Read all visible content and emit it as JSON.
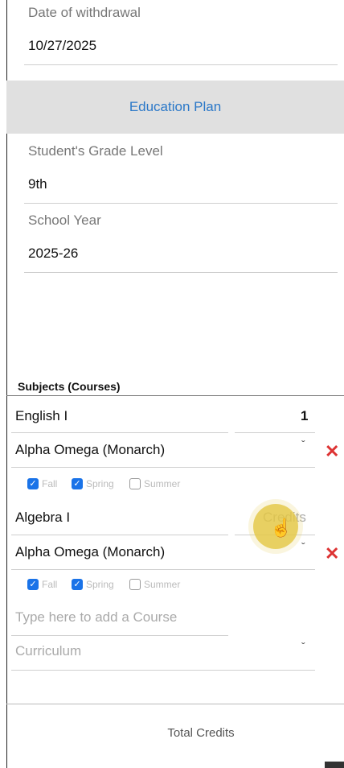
{
  "withdrawal": {
    "label": "Date of withdrawal",
    "value": "10/27/2025"
  },
  "education_plan": {
    "title": "Education Plan"
  },
  "grade": {
    "label": "Student's Grade Level",
    "value": "9th"
  },
  "school_year": {
    "label": "School Year",
    "value": "2025-26"
  },
  "subjects": {
    "title": "Subjects (Courses)",
    "courses": [
      {
        "name": "English I",
        "credits": "1",
        "curriculum": "Alpha Omega (Monarch)",
        "terms": [
          {
            "label": "Fall",
            "checked": true
          },
          {
            "label": "Spring",
            "checked": true
          },
          {
            "label": "Summer",
            "checked": false
          }
        ]
      },
      {
        "name": "Algebra I",
        "credits_placeholder": "Credits",
        "curriculum": "Alpha Omega (Monarch)",
        "terms": [
          {
            "label": "Fall",
            "checked": true
          },
          {
            "label": "Spring",
            "checked": true
          },
          {
            "label": "Summer",
            "checked": false
          }
        ]
      }
    ],
    "new_course_placeholder": "Type here to add a Course",
    "curriculum_placeholder": "Curriculum"
  },
  "total_credits_label": "Total Credits",
  "icons": {
    "delete": "close-x-icon",
    "dropdown": "chevron-down-icon",
    "cursor": "hand-pointer-icon"
  },
  "colors": {
    "accent": "#2b78c8",
    "delete": "#d33333",
    "checkbox": "#1a73e8",
    "band": "#e0e0e0"
  }
}
